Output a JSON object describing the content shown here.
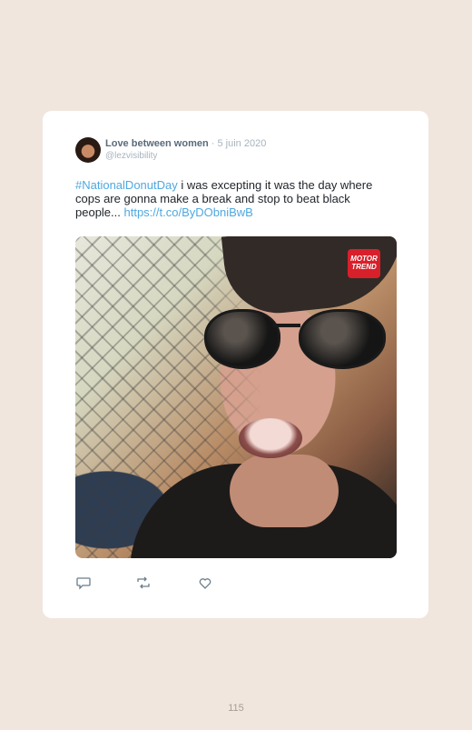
{
  "tweet": {
    "author_name": "Love between women",
    "separator": "·",
    "date": "5 juin 2020",
    "handle": "@lezvisibility",
    "hashtag": "#NationalDonutDay",
    "text": " i was excepting it was the day where cops are gonna make a break and stop to beat black people... ",
    "link": "https://t.co/ByDObniBwB",
    "media": {
      "logo_line1": "MOTOR",
      "logo_line2": "TREND"
    }
  },
  "actions": {
    "icons": [
      "reply-icon",
      "retweet-icon",
      "like-icon"
    ]
  },
  "page": {
    "number": "115"
  },
  "colors": {
    "background": "#f1e6dd",
    "card": "#ffffff",
    "link": "#4fa8e0",
    "logo": "#d8202a"
  }
}
